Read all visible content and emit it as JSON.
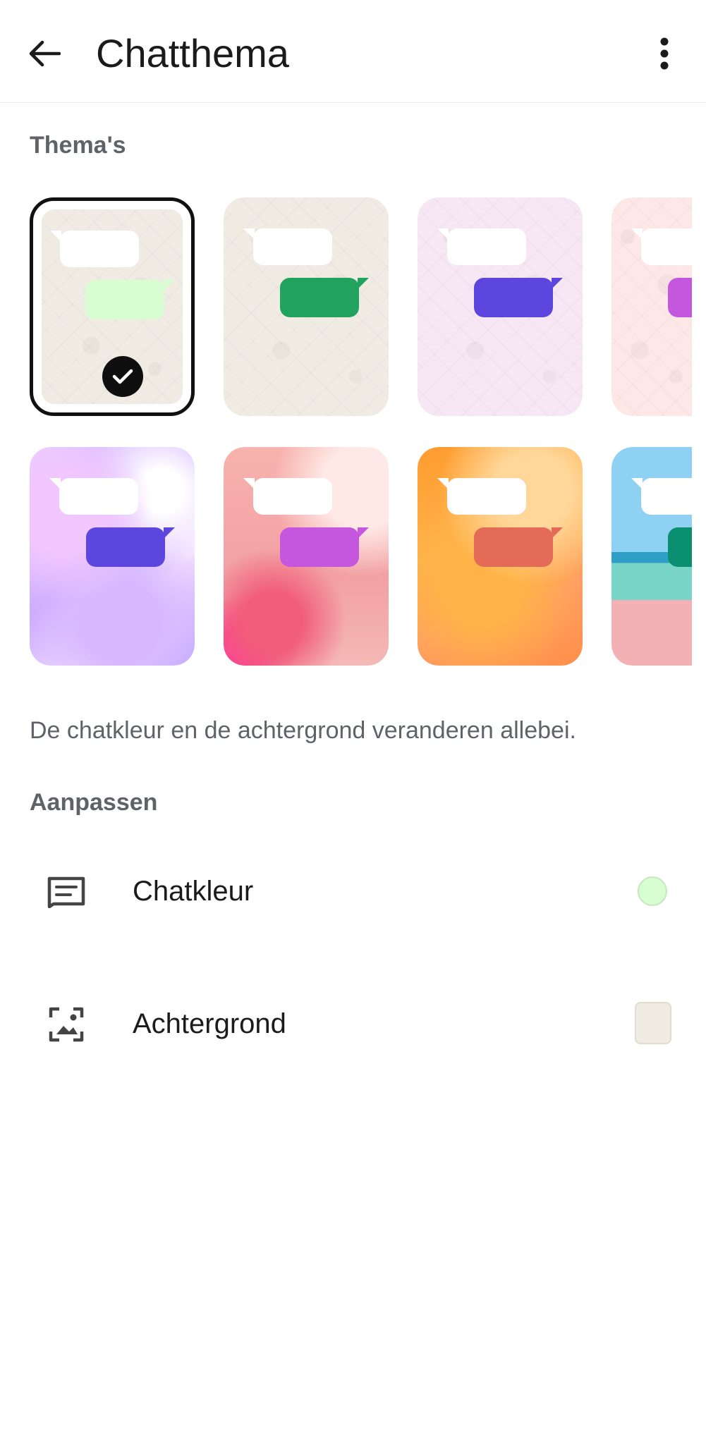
{
  "header": {
    "title": "Chatthema",
    "back_icon": "arrow-left-icon",
    "more_icon": "more-vertical-icon"
  },
  "themes_section": {
    "label": "Thema's"
  },
  "themes": [
    {
      "id": "default",
      "accent": "#d9fdd3",
      "background": "#f0ebe3",
      "selected": true
    },
    {
      "id": "green",
      "accent": "#21a35d",
      "background": "#f0ebe3",
      "selected": false
    },
    {
      "id": "blue-violet",
      "accent": "#5d46de",
      "background": "#f7e6f3",
      "selected": false
    },
    {
      "id": "purple",
      "accent": "#c457dd",
      "background": "#fde7e7",
      "selected": false
    },
    {
      "id": "holographic",
      "accent": "#5d46de",
      "selected": false
    },
    {
      "id": "pink-flowers",
      "accent": "#c457dd",
      "selected": false
    },
    {
      "id": "orange-smoke",
      "accent": "#e36b58",
      "selected": false
    },
    {
      "id": "beach",
      "accent": "#0b8f71",
      "selected": false
    }
  ],
  "description": "De chatkleur en de achtergrond veranderen allebei.",
  "customize_section": {
    "label": "Aanpassen"
  },
  "settings": {
    "chat_color": {
      "label": "Chatkleur",
      "icon": "chat-bubble-icon",
      "swatch": "#d9fdd3"
    },
    "wallpaper": {
      "label": "Achtergrond",
      "icon": "wallpaper-icon",
      "swatch": "#f0ebe3"
    }
  },
  "colors": {
    "selected_border": "#111111",
    "check_bg": "#0f0f0f"
  }
}
